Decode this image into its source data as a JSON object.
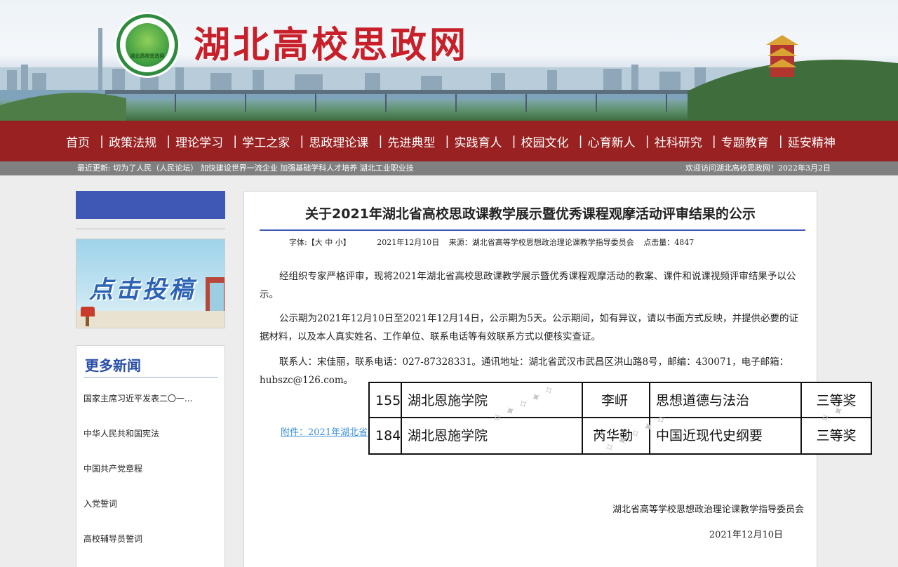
{
  "header": {
    "site_title": "湖北高校思政网",
    "logo_text": "湖北高校思政网"
  },
  "nav": {
    "items": [
      "首页",
      "政策法规",
      "理论学习",
      "学工之家",
      "思政理论课",
      "先进典型",
      "实践育人",
      "校园文化",
      "心育新人",
      "社科研究",
      "专题教育",
      "延安精神"
    ]
  },
  "ticker": {
    "left": "最近更新:  切为了人民（人民论坛）  加快建设世界一流企业 加强基础学科人才培养  湖北工业职业技",
    "right": "欢迎访问湖北高校思政网！2022年3月2日"
  },
  "sidebar": {
    "submit_label": "点击投稿",
    "more_news_title": "更多新闻",
    "news_items": [
      "国家主席习近平发表二〇一...",
      "中华人民共和国宪法",
      "中国共产党章程",
      "入党誓词",
      "高校辅导员誓词"
    ]
  },
  "article": {
    "title": "关于2021年湖北省高校思政课教学展示暨优秀课程观摩活动评审结果的公示",
    "font_label": "字体:【大 中 小】",
    "date": "2021年12月10日",
    "source": "来源：湖北省高等学校思想政治理论课教学指导委员会",
    "clicks": "点击量：4847",
    "para1": "经组织专家严格评审，现将2021年湖北省高校思政课教学展示暨优秀课程观摩活动的教案、课件和说课视频评审结果予以公示。",
    "para2": "公示期为2021年12月10日至2021年12月14日，公示期为5天。公示期间，如有异议，请以书面方式反映，并提供必要的证据材料，以及本人真实姓名、工作单位、联系电话等有效联系方式以便核实查证。",
    "para3": "联系人：宋佳丽，联系电话：027-87328331。通讯地址：湖北省武汉市武昌区洪山路8号，邮编：430071，电子邮箱：hubszc@126.com。",
    "attachment": "附件：2021年湖北省",
    "signature": "湖北省高等学校思想政治理论课教学指导委员会",
    "sign_date": "2021年12月10日"
  },
  "overlay_table": {
    "rows": [
      {
        "no": "155",
        "school": "湖北恩施学院",
        "name": "李岍",
        "course": "思想道德与法治",
        "award": "三等奖"
      },
      {
        "no": "184",
        "school": "湖北恩施学院",
        "name": "芮华勤",
        "course": "中国近现代史纲要",
        "award": "三等奖"
      }
    ]
  },
  "colors": {
    "nav_bg": "#9a2121",
    "title_red": "#c8202a",
    "accent_blue": "#3f57b5",
    "link_blue": "#3a8fd9"
  }
}
